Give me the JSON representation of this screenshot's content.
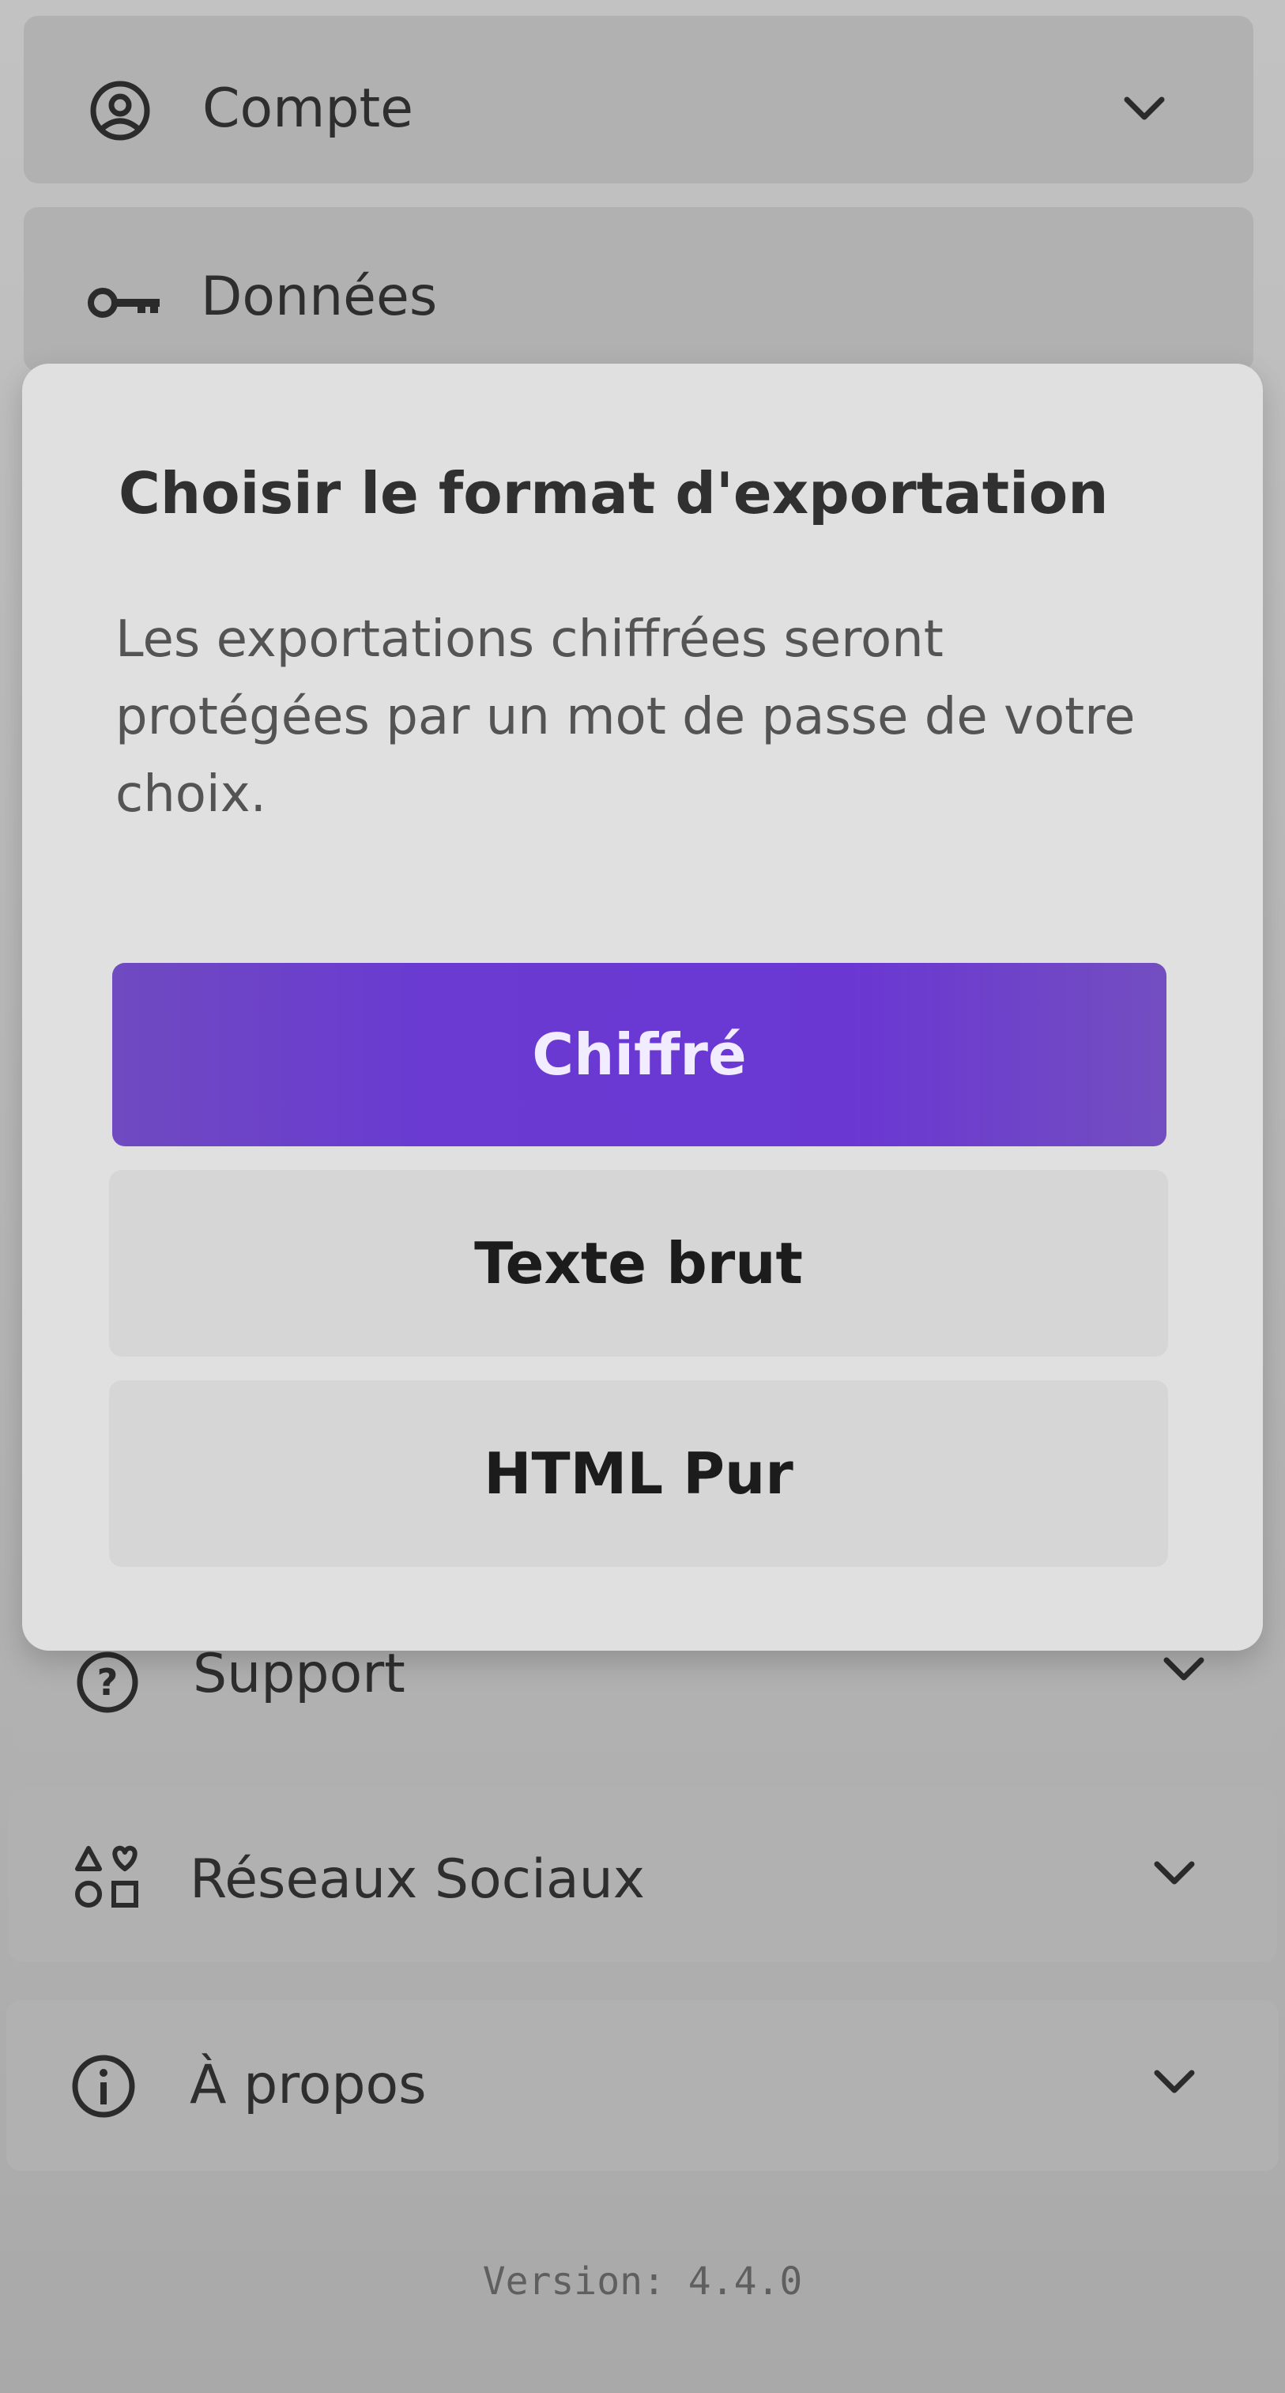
{
  "settings": {
    "sections": [
      {
        "label": "Compte",
        "icon": "account-circle-icon"
      },
      {
        "label": "Données",
        "icon": "key-icon"
      },
      {
        "label": "Support",
        "icon": "help-circle-icon"
      },
      {
        "label": "Réseaux Sociaux",
        "icon": "social-shapes-icon"
      },
      {
        "label": "À propos",
        "icon": "info-circle-icon"
      }
    ],
    "version": "Version: 4.4.0"
  },
  "dialog": {
    "title": "Choisir le format d'exportation",
    "message": "Les exportations chiffrées seront protégées par un mot de passe de votre choix.",
    "buttons": {
      "encrypted": "Chiffré",
      "plain_text": "Texte brut",
      "html": "HTML Pur"
    }
  },
  "colors": {
    "accent": "#6a37d2",
    "background": "#b8b8b8",
    "dialog": "#e0e0e0"
  }
}
